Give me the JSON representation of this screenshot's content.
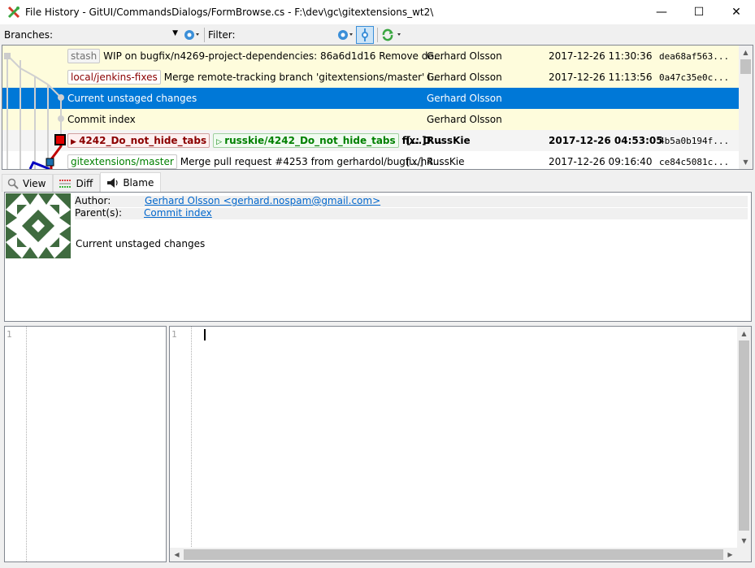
{
  "window": {
    "title": "File History - GitUI/CommandsDialogs/FormBrowse.cs - F:\\dev\\gc\\gitextensions_wt2\\",
    "minimize": "—",
    "maximize": "☐",
    "close": "✕"
  },
  "toolbar": {
    "branches_label": "Branches:",
    "filter_label": "Filter:"
  },
  "revisions": [
    {
      "labels": [
        {
          "text": "stash",
          "kind": "stash"
        }
      ],
      "message": "WIP on bugfix/n4269-project-dependencies: 86a6d1d16 Remove de...",
      "author": "Gerhard Olsson",
      "date": "2017-12-26 11:30:36",
      "hash": "dea68af563..."
    },
    {
      "labels": [
        {
          "text": "local/jenkins-fixes",
          "kind": "local"
        }
      ],
      "message": "Merge remote-tracking branch 'gitextensions/master' i...",
      "author": "Gerhard Olsson",
      "date": "2017-12-26 11:13:56",
      "hash": "0a47c35e0c..."
    },
    {
      "labels": [],
      "message": "Current unstaged changes",
      "author": "Gerhard Olsson",
      "date": "",
      "hash": ""
    },
    {
      "labels": [],
      "message": "Commit index",
      "author": "Gerhard Olsson",
      "date": "",
      "hash": ""
    },
    {
      "labels": [
        {
          "text": "4242_Do_not_hide_tabs",
          "kind": "red"
        },
        {
          "text": "russkie/4242_Do_not_hide_tabs",
          "kind": "green"
        }
      ],
      "message": "fix: D...",
      "more": "[...]",
      "author": "RussKie",
      "date": "2017-12-26 04:53:05",
      "hash": "4b5a0b194f..."
    },
    {
      "labels": [
        {
          "text": "gitextensions/master",
          "kind": "master"
        }
      ],
      "message": "Merge pull request #4253 from gerhardol/bugfix/n4...",
      "more": "[...]",
      "author": "RussKie",
      "date": "2017-12-26 09:16:40",
      "hash": "ce84c5081c..."
    }
  ],
  "tabs": [
    {
      "label": "View",
      "icon": "magnifier-icon"
    },
    {
      "label": "Diff",
      "icon": "diff-icon"
    },
    {
      "label": "Blame",
      "icon": "blame-icon"
    }
  ],
  "commit_info": {
    "author_label": "Author:",
    "author_value": "Gerhard Olsson <gerhard.nospam@gmail.com>",
    "parents_label": "Parent(s):",
    "parents_value": "Commit index",
    "message": "Current unstaged changes"
  },
  "editor": {
    "left_line": "1",
    "right_line": "1"
  },
  "colors": {
    "selection": "#0078d7",
    "unstaged_row": "#fefcdc",
    "avatar_green": "#3f6b3f"
  }
}
